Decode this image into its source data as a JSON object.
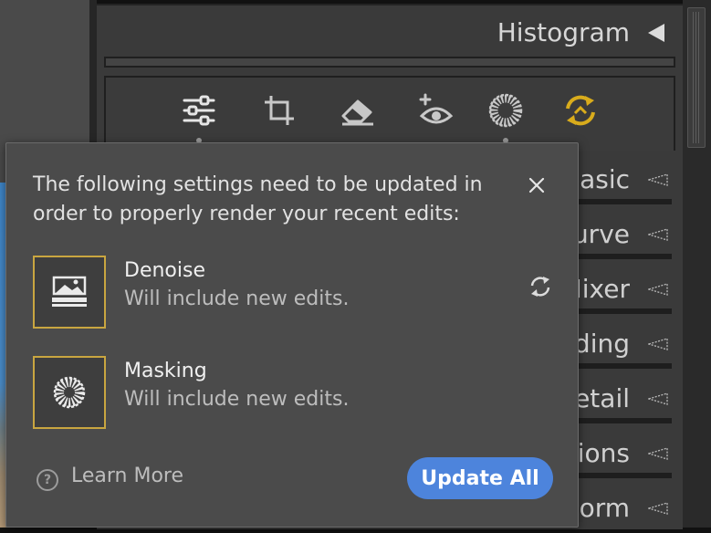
{
  "panel": {
    "histogram_title": "Histogram",
    "sections": [
      {
        "label": "Basic"
      },
      {
        "label": "urve"
      },
      {
        "label": "Mixer"
      },
      {
        "label": "ding"
      },
      {
        "label": "etail"
      },
      {
        "label": "ions"
      },
      {
        "label": "orm"
      }
    ],
    "tools": [
      "sliders-icon",
      "crop-icon",
      "eraser-icon",
      "red-eye-icon",
      "masking-icon",
      "sync-icon"
    ]
  },
  "dialog": {
    "message": "The following settings need to be updated in order to properly render your recent edits:",
    "items": [
      {
        "title": "Denoise",
        "subtitle": "Will include new edits."
      },
      {
        "title": "Masking",
        "subtitle": "Will include new edits."
      }
    ],
    "learn_more": "Learn More",
    "learn_icon": "?",
    "update_all": "Update All"
  },
  "colors": {
    "accent": "#4d84dc",
    "item_border": "#c9a640",
    "sync_icon": "#d9ac1c"
  }
}
